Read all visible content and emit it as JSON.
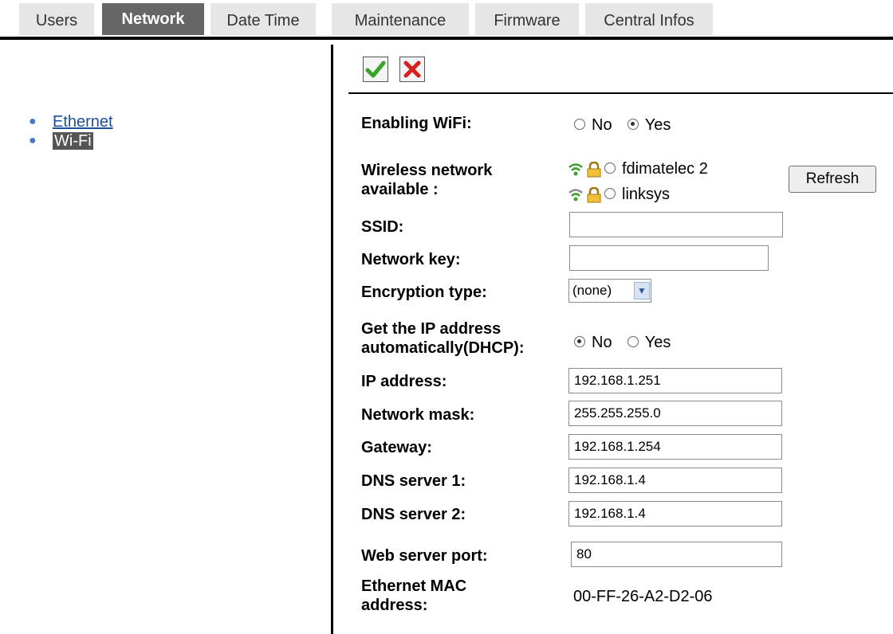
{
  "tabs": [
    {
      "label": "Users",
      "active": false
    },
    {
      "label": "Network",
      "active": true
    },
    {
      "label": "Date Time",
      "active": false
    },
    {
      "label": "Maintenance",
      "active": false
    },
    {
      "label": "Firmware",
      "active": false
    },
    {
      "label": "Central Infos",
      "active": false
    }
  ],
  "sidebar": {
    "items": [
      {
        "label": "Ethernet",
        "selected": false
      },
      {
        "label": "Wi-Fi",
        "selected": true
      }
    ]
  },
  "toolbar": {
    "ok_icon": "check-icon",
    "cancel_icon": "x-icon",
    "ok_color": "#3aa12a",
    "cancel_color": "#d81f1f"
  },
  "form": {
    "enabling_wifi": {
      "label": "Enabling WiFi:",
      "options": [
        "No",
        "Yes"
      ],
      "selected": "Yes"
    },
    "wireless": {
      "label_line1": "Wireless network",
      "label_line2": "available :",
      "networks": [
        {
          "name": "fdimatelec 2",
          "signal_icon": "wifi-icon",
          "signal_color": "#3aa12a",
          "lock_icon": "lock-icon"
        },
        {
          "name": "linksys",
          "signal_icon": "wifi-icon",
          "signal_color": "#8a8a8a",
          "lock_icon": "lock-icon"
        }
      ],
      "refresh_label": "Refresh"
    },
    "ssid": {
      "label": "SSID:",
      "value": ""
    },
    "network_key": {
      "label": "Network key:",
      "value": ""
    },
    "encryption": {
      "label": "Encryption type:",
      "value": "(none)"
    },
    "dhcp": {
      "label_line1": "Get the IP address",
      "label_line2": "automatically(DHCP):",
      "options": [
        "No",
        "Yes"
      ],
      "selected": "No"
    },
    "ip": {
      "label": "IP address:",
      "value": "192.168.1.251"
    },
    "mask": {
      "label": "Network mask:",
      "value": "255.255.255.0"
    },
    "gateway": {
      "label": "Gateway:",
      "value": "192.168.1.254"
    },
    "dns1": {
      "label": "DNS server 1:",
      "value": "192.168.1.4"
    },
    "dns2": {
      "label": "DNS server 2:",
      "value": "192.168.1.4"
    },
    "web_port": {
      "label": "Web server port:",
      "value": "80"
    },
    "mac": {
      "label_line1": "Ethernet MAC",
      "label_line2": "address:",
      "value": "00-FF-26-A2-D2-06"
    }
  }
}
